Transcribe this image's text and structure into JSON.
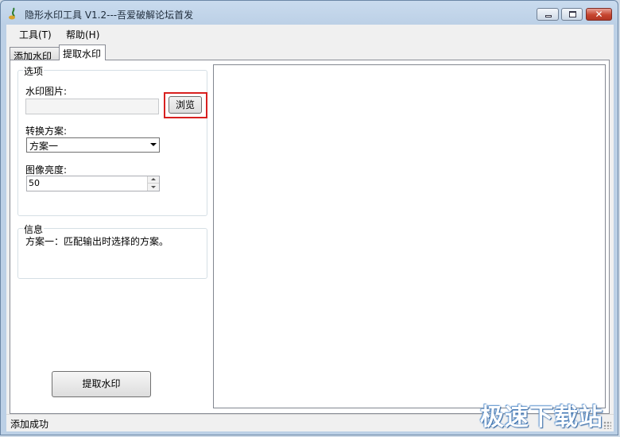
{
  "window": {
    "title": "隐形水印工具 V1.2---吾爱破解论坛首发",
    "controls": {
      "minimize_icon": "minimize-icon",
      "maximize_icon": "maximize-icon",
      "close_glyph": "✕"
    }
  },
  "menu": {
    "tools": "工具(T)",
    "help": "帮助(H)"
  },
  "tabs": [
    {
      "label": "添加水印",
      "active": false
    },
    {
      "label": "提取水印",
      "active": true
    }
  ],
  "options": {
    "group_label": "选项",
    "watermark_image_label": "水印图片:",
    "watermark_image_value": "",
    "browse_label": "浏览",
    "scheme_label": "转换方案:",
    "scheme_value": "方案一",
    "brightness_label": "图像亮度:",
    "brightness_value": "50"
  },
  "info": {
    "group_label": "信息",
    "text": "方案一：匹配输出时选择的方案。"
  },
  "extract_button": "提取水印",
  "status": "添加成功",
  "watermark_text": "极速下载站",
  "colors": {
    "highlight": "#d8201f",
    "titlebar": "#bcd0e6",
    "close_button": "#c6452f"
  }
}
